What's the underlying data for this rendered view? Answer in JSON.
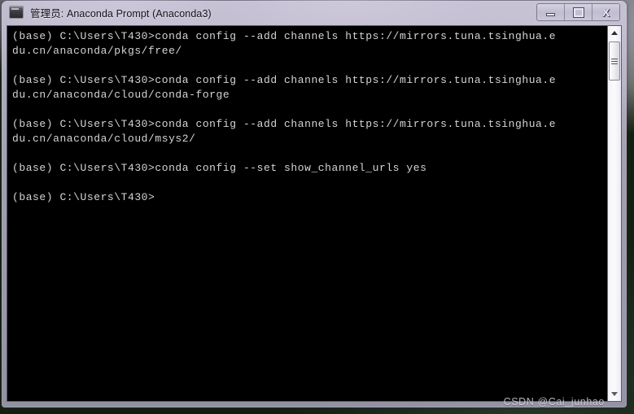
{
  "window": {
    "title": "管理员: Anaconda Prompt (Anaconda3)",
    "icon": "console-icon",
    "buttons": {
      "minimize": "—",
      "maximize": "□",
      "close": "X"
    }
  },
  "terminal": {
    "background_color": "#000000",
    "text_color": "#d4d4d4",
    "lines": [
      "(base) C:\\Users\\T430>conda config --add channels https://mirrors.tuna.tsinghua.e",
      "du.cn/anaconda/pkgs/free/",
      "",
      "(base) C:\\Users\\T430>conda config --add channels https://mirrors.tuna.tsinghua.e",
      "du.cn/anaconda/cloud/conda-forge",
      "",
      "(base) C:\\Users\\T430>conda config --add channels https://mirrors.tuna.tsinghua.e",
      "du.cn/anaconda/cloud/msys2/",
      "",
      "(base) C:\\Users\\T430>conda config --set show_channel_urls yes",
      "",
      "(base) C:\\Users\\T430>"
    ]
  },
  "scrollbar": {
    "up_arrow": "scroll-up-arrow",
    "down_arrow": "scroll-down-arrow",
    "thumb": "scroll-thumb"
  },
  "watermark": {
    "text": "CSDN @Cai_junhao"
  }
}
